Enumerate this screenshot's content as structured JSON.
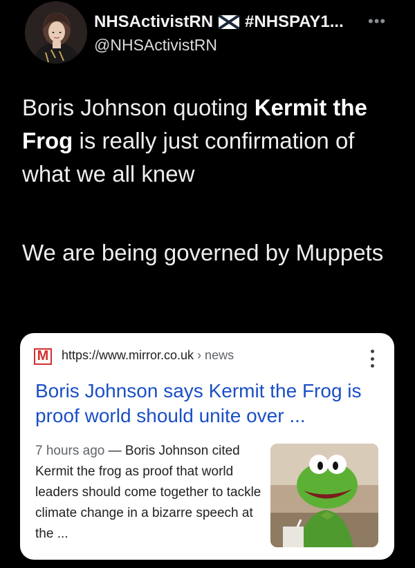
{
  "tweet": {
    "display_name": "NHSActivistRN",
    "name_suffix": "#NHSPAY1...",
    "flag_icon": "scotland-flag-icon",
    "handle": "@NHSActivistRN",
    "more_icon": "more-icon",
    "text_p1_a": "Boris Johnson quoting ",
    "text_p1_bold": "Kermit the Frog",
    "text_p1_b": " is really just confirmation of what we all knew",
    "text_p2": "We are being governed by Muppets"
  },
  "card": {
    "favicon_letter": "M",
    "favicon_color": "#d32f2f",
    "url": "https://www.mirror.co.uk",
    "breadcrumb": " › news",
    "menu_icon": "kebab-menu-icon",
    "title": "Boris Johnson says Kermit the Frog is proof world should unite over ...",
    "title_color": "#1a4fc4",
    "time": "7 hours ago",
    "snippet": " — Boris Johnson cited Kermit the frog as proof that world leaders should come together to tackle climate change in a bizarre speech at the ..."
  }
}
